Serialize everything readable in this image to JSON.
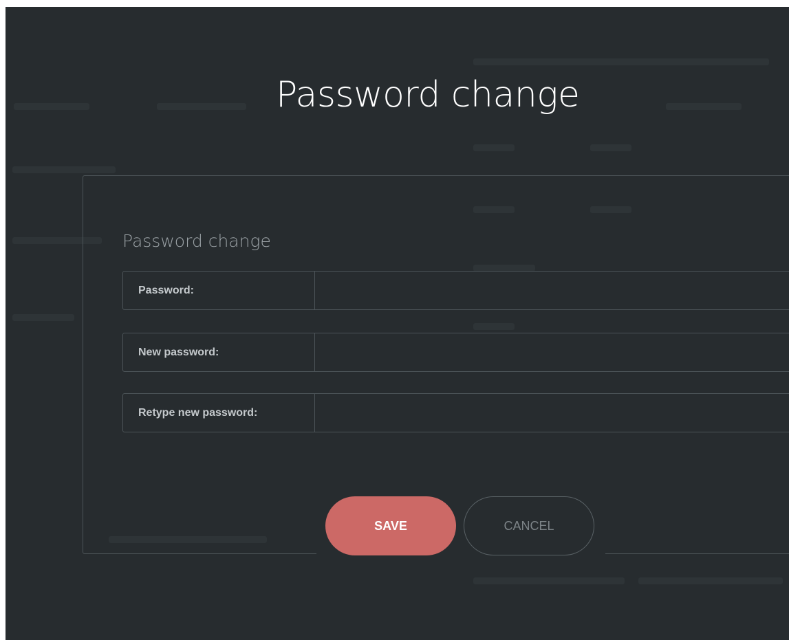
{
  "page": {
    "heading": "Password change"
  },
  "form": {
    "title": "Password change",
    "fields": [
      {
        "label": "Password:",
        "value": ""
      },
      {
        "label": "New password:",
        "value": ""
      },
      {
        "label": "Retype new password:",
        "value": ""
      }
    ]
  },
  "actions": {
    "save_label": "SAVE",
    "cancel_label": "CANCEL"
  },
  "colors": {
    "background": "#272c2f",
    "save_button": "#cc6966",
    "border": "#4c5458"
  }
}
